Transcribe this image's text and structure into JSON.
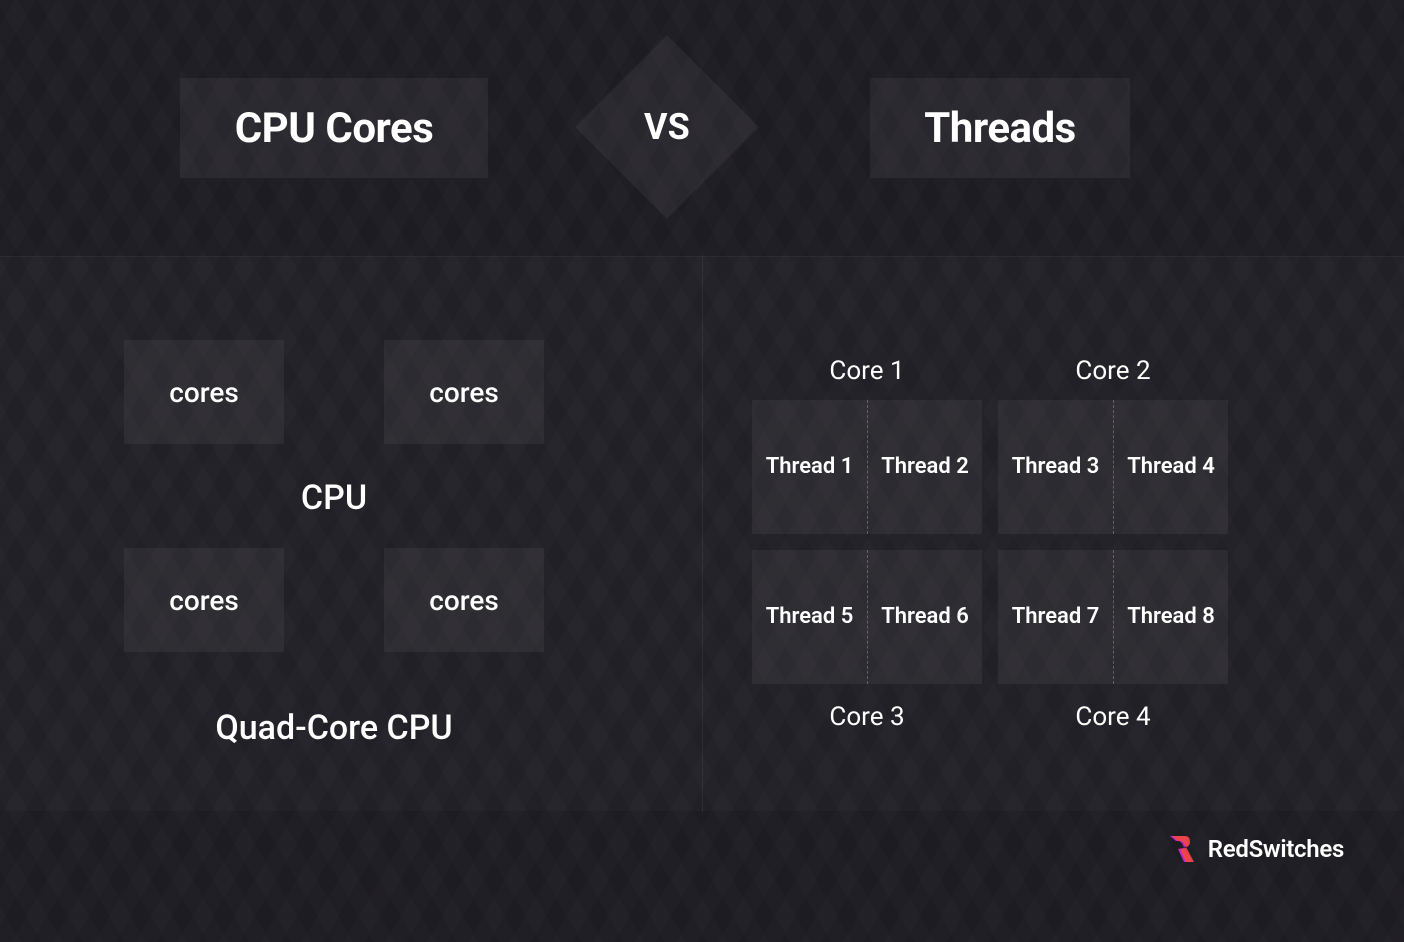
{
  "header": {
    "left_title": "CPU Cores",
    "right_title": "Threads",
    "vs_label": "VS"
  },
  "left": {
    "box_label": "cores",
    "center_label": "CPU",
    "footer_label": "Quad-Core CPU"
  },
  "right": {
    "core_labels": [
      "Core 1",
      "Core 2",
      "Core 3",
      "Core 4"
    ],
    "threads": [
      "Thread 1",
      "Thread 2",
      "Thread 3",
      "Thread 4",
      "Thread 5",
      "Thread 6",
      "Thread 7",
      "Thread 8"
    ]
  },
  "brand": {
    "name": "RedSwitches"
  }
}
